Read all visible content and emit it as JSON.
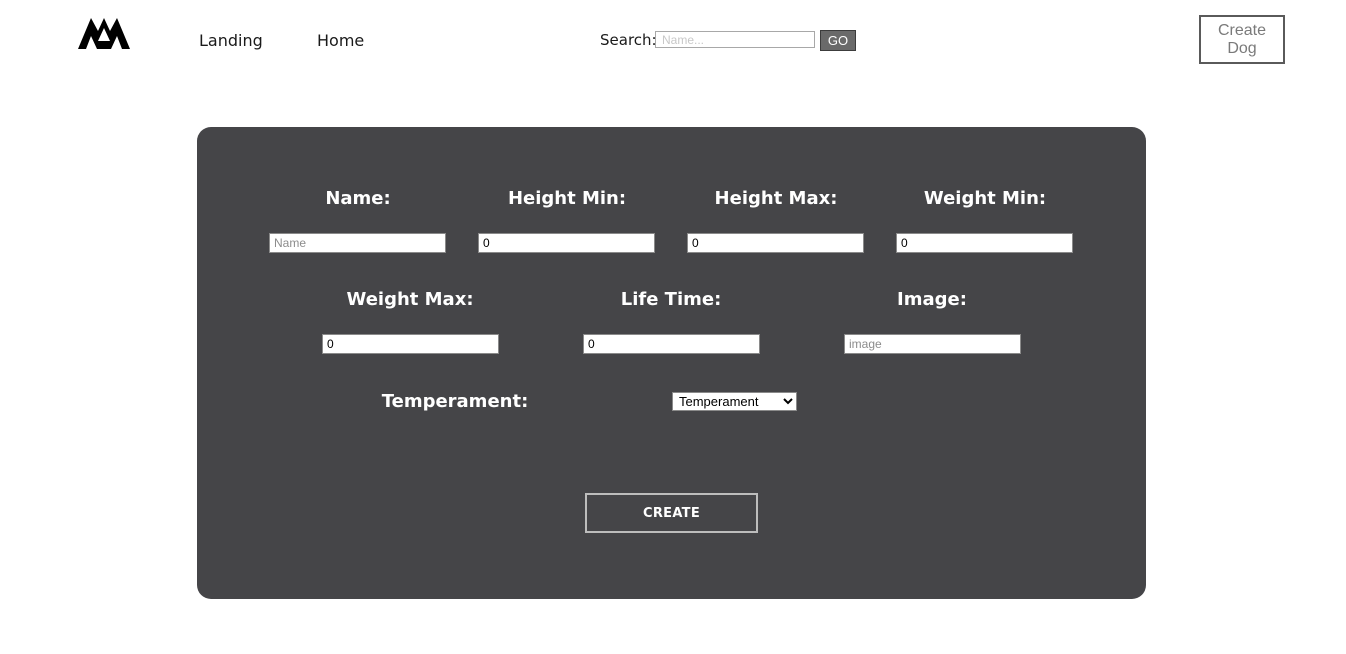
{
  "header": {
    "nav": [
      {
        "label": "Landing"
      },
      {
        "label": "Home"
      }
    ],
    "search": {
      "label": "Search:",
      "placeholder": "Name...",
      "button_label": "GO"
    },
    "create_dog_label": "Create Dog"
  },
  "form": {
    "fields": [
      {
        "label": "Name:",
        "value": "",
        "placeholder": "Name"
      },
      {
        "label": "Height Min:",
        "value": "0",
        "placeholder": ""
      },
      {
        "label": "Height Max:",
        "value": "0",
        "placeholder": ""
      },
      {
        "label": "Weight Min:",
        "value": "0",
        "placeholder": ""
      },
      {
        "label": "Weight Max:",
        "value": "0",
        "placeholder": ""
      },
      {
        "label": "Life Time:",
        "value": "0",
        "placeholder": ""
      },
      {
        "label": "Image:",
        "value": "",
        "placeholder": "image"
      }
    ],
    "temperament": {
      "label": "Temperament:",
      "selected": "Temperament"
    },
    "submit_label": "CREATE"
  },
  "colors": {
    "panel_bg": "#454548",
    "go_button_bg": "#6a6a6a",
    "text_on_panel": "#ffffff"
  },
  "icons": {
    "logo": "double-peak-logo-icon",
    "select_arrow": "chevron-down-icon"
  }
}
